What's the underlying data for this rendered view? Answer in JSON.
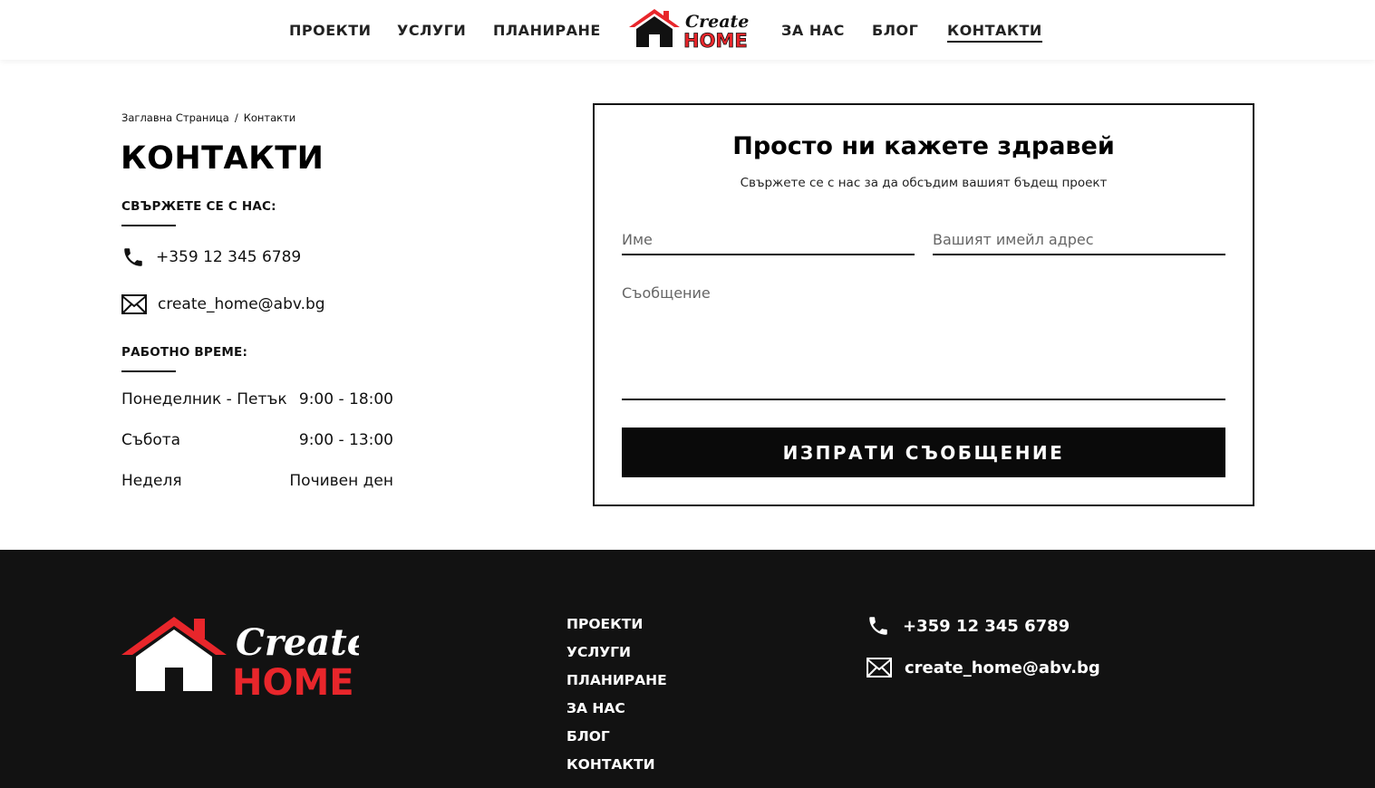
{
  "header": {
    "nav_left": [
      "ПРОЕКТИ",
      "УСЛУГИ",
      "ПЛАНИРАНЕ"
    ],
    "nav_right": [
      "ЗА НАС",
      "БЛОГ",
      "КОНТАКТИ"
    ],
    "active": "КОНТАКТИ",
    "logo": {
      "script": "Create",
      "word": "HOME",
      "icon": "house-logo-icon"
    }
  },
  "breadcrumb": {
    "home": "Заглавна Страница",
    "separator": "/",
    "current": "Контакти"
  },
  "page_title": "КОНТАКТИ",
  "contact": {
    "label": "СВЪРЖЕТЕ СЕ С НАС:",
    "phone": "+359 12 345 6789",
    "email": "create_home@abv.bg",
    "phone_icon": "phone-icon",
    "email_icon": "envelope-icon"
  },
  "hours": {
    "label": "РАБОТНО ВРЕМЕ:",
    "rows": [
      {
        "day": "Понеделник - Петък",
        "time": "9:00 - 18:00"
      },
      {
        "day": "Събота",
        "time": "9:00 - 13:00"
      },
      {
        "day": "Неделя",
        "time": "Почивен ден"
      }
    ]
  },
  "form": {
    "title": "Просто ни кажете здравей",
    "subtitle": "Свържете се с нас за да обсъдим вашият бъдещ проект",
    "name_placeholder": "Име",
    "email_placeholder": "Вашият имейл адрес",
    "message_placeholder": "Съобщение",
    "submit_label": "ИЗПРАТИ СЪОБЩЕНИЕ"
  },
  "footer": {
    "nav": [
      "ПРОЕКТИ",
      "УСЛУГИ",
      "ПЛАНИРАНЕ",
      "ЗА НАС",
      "БЛОГ",
      "КОНТАКТИ"
    ],
    "phone": "+359 12 345 6789",
    "email": "create_home@abv.bg"
  },
  "colors": {
    "brand_red": "#e8262b",
    "dark": "#121212",
    "black": "#0a0a0a"
  }
}
